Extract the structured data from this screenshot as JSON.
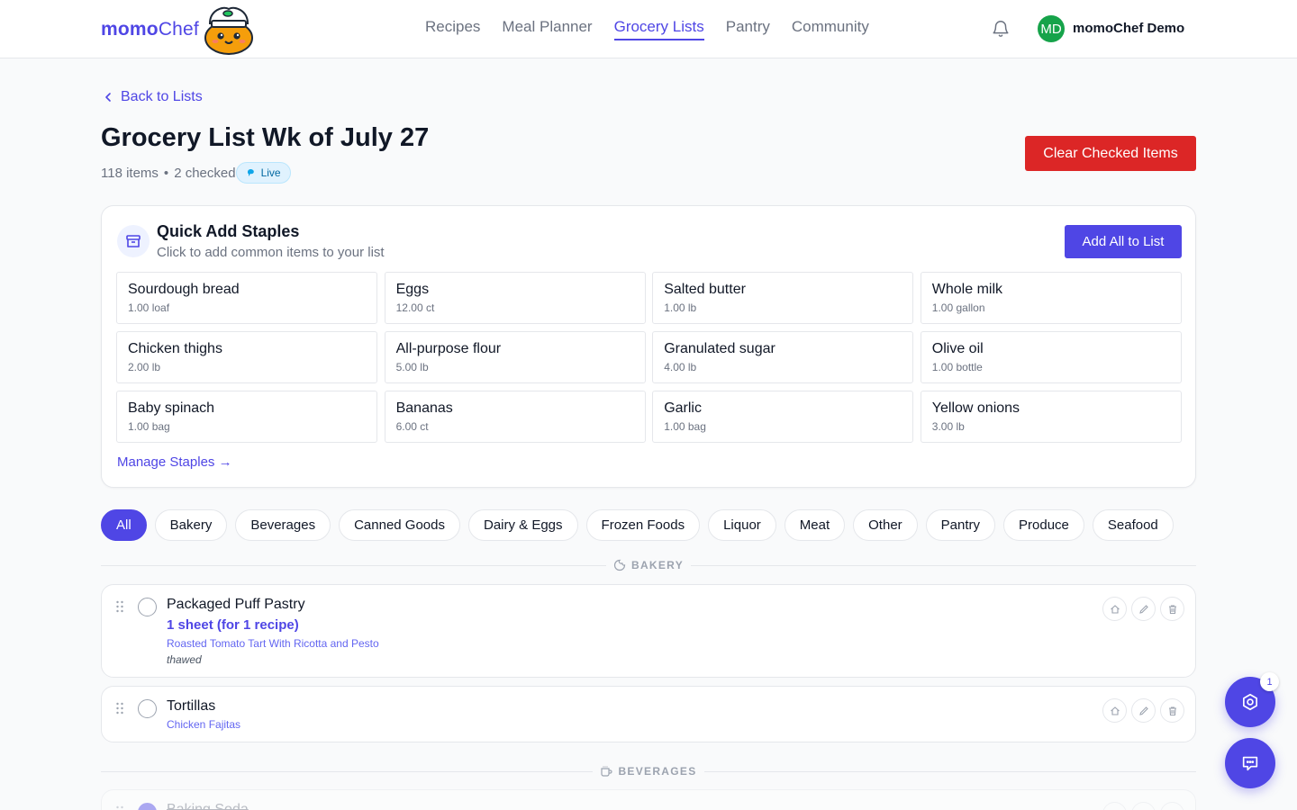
{
  "brand": {
    "name_bold": "momo",
    "name_rest": "Chef"
  },
  "nav": {
    "items": [
      {
        "label": "Recipes"
      },
      {
        "label": "Meal Planner"
      },
      {
        "label": "Grocery Lists",
        "active": true
      },
      {
        "label": "Pantry"
      },
      {
        "label": "Community"
      }
    ]
  },
  "user": {
    "initials": "MD",
    "name": "momoChef Demo"
  },
  "page": {
    "back_label": "Back to Lists",
    "title": "Grocery List Wk of July 27",
    "items_count": "118 items",
    "separator": "•",
    "checked_count": "2 checked",
    "live_label": "Live",
    "clear_label": "Clear Checked Items"
  },
  "staples": {
    "title": "Quick Add Staples",
    "subtitle": "Click to add common items to your list",
    "add_all_label": "Add All to List",
    "manage_label": "Manage Staples →",
    "items": [
      {
        "name": "Sourdough bread",
        "qty": "1.00 loaf"
      },
      {
        "name": "Eggs",
        "qty": "12.00 ct"
      },
      {
        "name": "Salted butter",
        "qty": "1.00 lb"
      },
      {
        "name": "Whole milk",
        "qty": "1.00 gallon"
      },
      {
        "name": "Chicken thighs",
        "qty": "2.00 lb"
      },
      {
        "name": "All-purpose flour",
        "qty": "5.00 lb"
      },
      {
        "name": "Granulated sugar",
        "qty": "4.00 lb"
      },
      {
        "name": "Olive oil",
        "qty": "1.00 bottle"
      },
      {
        "name": "Baby spinach",
        "qty": "1.00 bag"
      },
      {
        "name": "Bananas",
        "qty": "6.00 ct"
      },
      {
        "name": "Garlic",
        "qty": "1.00 bag"
      },
      {
        "name": "Yellow onions",
        "qty": "3.00 lb"
      }
    ]
  },
  "filters": {
    "chips": [
      "All",
      "Bakery",
      "Beverages",
      "Canned Goods",
      "Dairy & Eggs",
      "Frozen Foods",
      "Liquor",
      "Meat",
      "Other",
      "Pantry",
      "Produce",
      "Seafood"
    ],
    "active": "All"
  },
  "sections": [
    {
      "label": "BAKERY",
      "icon": "cookie-icon",
      "items": [
        {
          "name": "Packaged Puff Pastry",
          "qty": "1 sheet (for 1 recipe)",
          "recipe": "Roasted Tomato Tart With Ricotta and Pesto",
          "note": "thawed",
          "checked": false
        },
        {
          "name": "Tortillas",
          "recipe": "Chicken Fajitas",
          "checked": false
        }
      ]
    },
    {
      "label": "BEVERAGES",
      "icon": "cup-icon",
      "items": [
        {
          "name": "Baking Soda",
          "checked": true
        }
      ]
    }
  ],
  "fab": {
    "badge_count": "1"
  },
  "colors": {
    "accent": "#4f46e5",
    "danger": "#dc2626",
    "avatar": "#16a34a"
  }
}
